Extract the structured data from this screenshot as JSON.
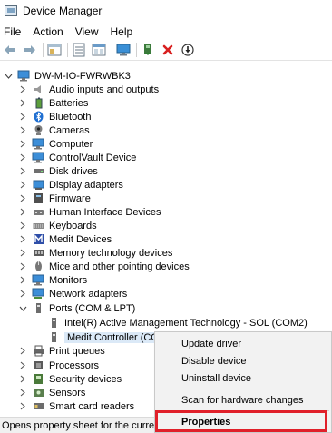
{
  "window": {
    "title": "Device Manager"
  },
  "menu": [
    "File",
    "Action",
    "View",
    "Help"
  ],
  "toolbar": {
    "buttons": [
      "back-arrow-icon",
      "forward-arrow-icon",
      "show-hide-console-tree-icon",
      "properties-icon",
      "help-icon",
      "scan-hardware-icon",
      "update-driver-icon",
      "uninstall-icon",
      "disable-device-icon"
    ]
  },
  "tree": {
    "computer": "DW-M-IO-FWRWBK3",
    "categories": [
      {
        "label": "Audio inputs and outputs",
        "icon": "speaker-icon"
      },
      {
        "label": "Batteries",
        "icon": "battery-icon"
      },
      {
        "label": "Bluetooth",
        "icon": "bluetooth-icon"
      },
      {
        "label": "Cameras",
        "icon": "camera-icon"
      },
      {
        "label": "Computer",
        "icon": "computer-icon"
      },
      {
        "label": "ControlVault Device",
        "icon": "controlvault-icon"
      },
      {
        "label": "Disk drives",
        "icon": "disk-drive-icon"
      },
      {
        "label": "Display adapters",
        "icon": "display-adapter-icon"
      },
      {
        "label": "Firmware",
        "icon": "firmware-icon"
      },
      {
        "label": "Human Interface Devices",
        "icon": "hid-icon"
      },
      {
        "label": "Keyboards",
        "icon": "keyboard-icon"
      },
      {
        "label": "Medit Devices",
        "icon": "medit-icon"
      },
      {
        "label": "Memory technology devices",
        "icon": "memory-icon"
      },
      {
        "label": "Mice and other pointing devices",
        "icon": "mouse-icon"
      },
      {
        "label": "Monitors",
        "icon": "monitor-icon"
      },
      {
        "label": "Network adapters",
        "icon": "network-adapter-icon"
      },
      {
        "label": "Ports (COM & LPT)",
        "icon": "port-icon"
      }
    ],
    "port_children": [
      "Intel(R) Active Management Technology - SOL (COM2)",
      "Medit Controller (COM"
    ],
    "after_categories": [
      {
        "label": "Print queues",
        "icon": "printer-icon"
      },
      {
        "label": "Processors",
        "icon": "processor-icon"
      },
      {
        "label": "Security devices",
        "icon": "security-icon"
      },
      {
        "label": "Sensors",
        "icon": "sensor-icon"
      },
      {
        "label": "Smart card readers",
        "icon": "smartcard-icon"
      }
    ]
  },
  "context_menu": {
    "items": [
      "Update driver",
      "Disable device",
      "Uninstall device",
      "Scan for hardware changes",
      "Properties"
    ]
  },
  "status": "Opens property sheet for the current s",
  "colors": {
    "highlight_border": "#e0202a",
    "selection": "#dbe9f7"
  }
}
